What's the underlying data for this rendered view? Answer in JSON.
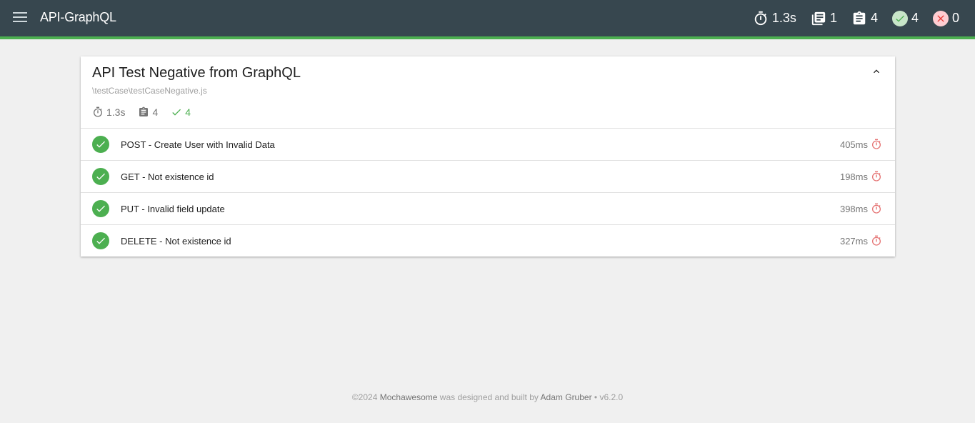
{
  "nav": {
    "title": "API-GraphQL",
    "menu_icon": "menu-icon",
    "stats": {
      "duration": "1.3s",
      "suites": "1",
      "tests": "4",
      "passes": "4",
      "failures": "0"
    }
  },
  "suite": {
    "title": "API Test Negative from GraphQL",
    "file": "\\testCase\\testCaseNegative.js",
    "stats": {
      "duration": "1.3s",
      "tests": "4",
      "passes": "4"
    },
    "tests": [
      {
        "title": "POST - Create User with Invalid Data",
        "duration": "405ms",
        "status": "passed"
      },
      {
        "title": "GET - Not existence id",
        "duration": "198ms",
        "status": "passed"
      },
      {
        "title": "PUT - Invalid field update",
        "duration": "398ms",
        "status": "passed"
      },
      {
        "title": "DELETE - Not existence id",
        "duration": "327ms",
        "status": "passed"
      }
    ]
  },
  "footer": {
    "copyright": "©2024",
    "product": "Mochawesome",
    "middle": "was designed and built by",
    "author": "Adam Gruber",
    "version": "• v6.2.0"
  },
  "colors": {
    "navbar": "#37474f",
    "accent": "#4caf50",
    "pass": "#4caf50",
    "timer": "#e57373",
    "background": "#f0f0f0"
  }
}
